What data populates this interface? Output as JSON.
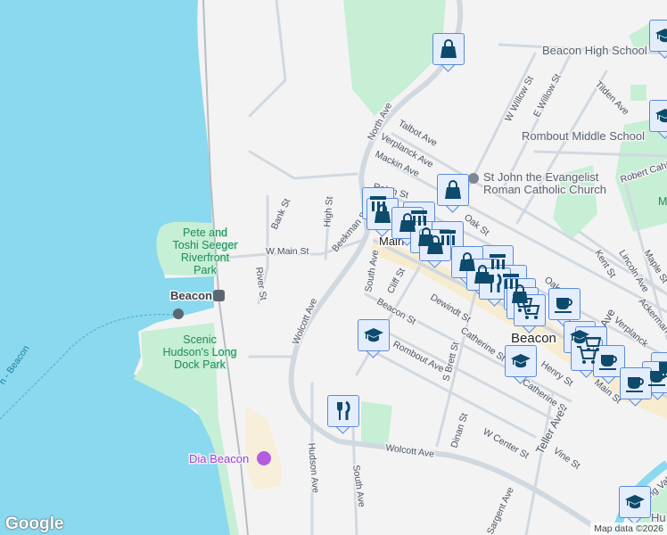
{
  "map": {
    "water_color": "#8ad9ee",
    "park_color": "#c6efd6",
    "marker_fill": "#e4edfc",
    "marker_icon_color": "#0d4a6b",
    "streets": {
      "north_ave": "North Ave",
      "talbot": "Talbot Ave",
      "verplanck": "Verplanck Ave",
      "mackin": "Mackin Ave",
      "ralph": "Ralph St",
      "oak": "Oak St",
      "oak2": "Oak St",
      "bank": "Bank St",
      "high": "High St",
      "beekman": "Beekman St",
      "w_main": "W Main St",
      "river": "River St",
      "wolcott": "Wolcott Ave",
      "wolcott2": "Wolcott Ave",
      "main": "Main",
      "main_st": "Main St",
      "south_ave": "South Ave",
      "south_ave2": "South Ave",
      "cliff": "Cliff St",
      "beacon_st": "Beacon St",
      "dewindt": "Dewindt St",
      "catherine": "Catherine St",
      "catherine2": "Catherine St",
      "rombout": "Rombout Ave",
      "s_brett": "S Brett St",
      "henry": "Henry St",
      "hudson_ave": "Hudson Ave",
      "dinan": "Dinan St",
      "w_center": "W Center St",
      "vine": "Vine St",
      "teller": "Teller Ave",
      "sargent": "Sargent Ave",
      "w_willow": "W Willow St",
      "e_willow": "E Willow St",
      "tilden": "Tilden Ave",
      "robert_cahill": "Robert Cahill",
      "kent": "Kent St",
      "lincoln": "Lincoln Ave",
      "maple": "Maple St",
      "ackerman": "Ackerman",
      "verplanck2": "Verplanck",
      "fishkill": "ing Valley",
      "ave": "Ave",
      "ferry": "h - Beacon"
    },
    "pois": {
      "beacon_high": "Beacon High School",
      "rombout_ms": "Rombout Middle School",
      "church_1": "St John the Evangelist",
      "church_2": "Roman Catholic Church",
      "station": "Beacon",
      "dia": "Dia Beacon",
      "town": "Beacon",
      "hu": "Hu",
      "m": "M"
    },
    "parks": {
      "seeger": [
        "Pete and",
        "Toshi Seeger",
        "Riverfront",
        "Park"
      ],
      "long_dock": [
        "Scenic",
        "Hudson's Long",
        "Dock Park"
      ]
    }
  },
  "branding": {
    "logo": "Google",
    "attribution": "Map data ©2026"
  }
}
